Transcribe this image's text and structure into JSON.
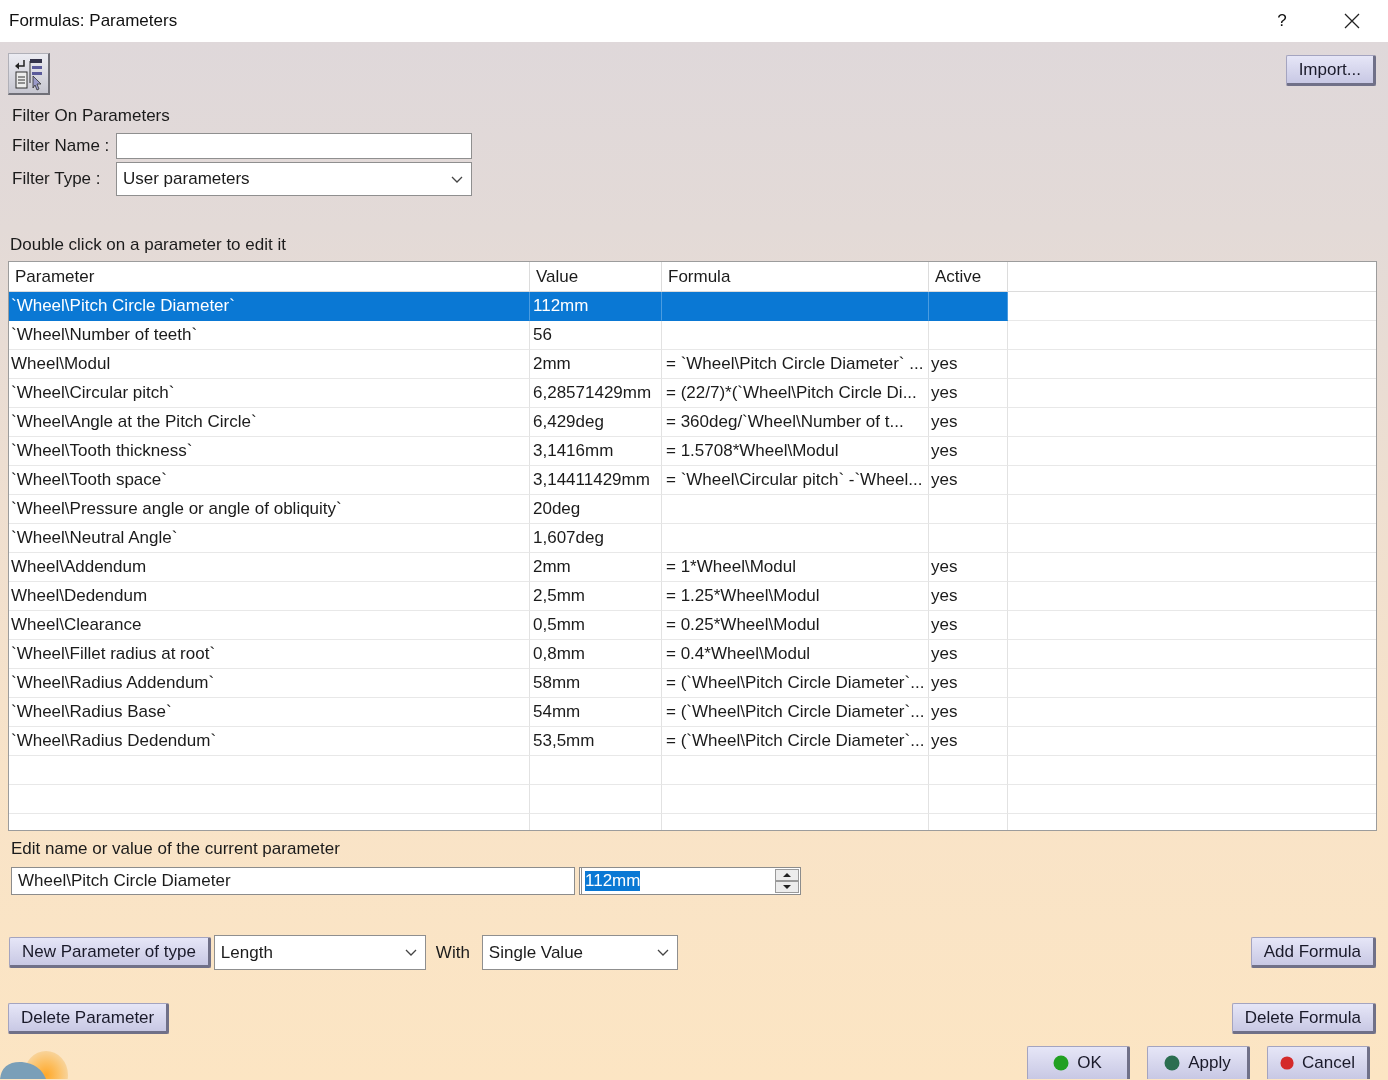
{
  "window": {
    "title": "Formulas: Parameters",
    "help": "?"
  },
  "toolbar": {
    "import_button": "Import..."
  },
  "filter": {
    "title": "Filter On Parameters",
    "name_label": "Filter Name :",
    "type_label": "Filter Type :",
    "type_value": "User parameters"
  },
  "table": {
    "hint": "Double click on a parameter to edit it",
    "columns": [
      "Parameter",
      "Value",
      "Formula",
      "Active"
    ],
    "rows": [
      {
        "parameter": "`Wheel\\Pitch Circle Diameter`",
        "value": "112mm",
        "selected": true
      },
      {
        "parameter": "`Wheel\\Number of teeth`",
        "value": "56",
        "selected": false
      },
      {
        "parameter": "Wheel\\Modul",
        "value": "2mm",
        "formula": "= `Wheel\\Pitch Circle Diameter` ...",
        "active": "yes",
        "selected": false
      },
      {
        "parameter": "`Wheel\\Circular pitch`",
        "value": "6,28571429mm",
        "formula": "= (22/7)*(`Wheel\\Pitch Circle Di...",
        "active": "yes",
        "selected": false
      },
      {
        "parameter": "`Wheel\\Angle at the Pitch Circle`",
        "value": "6,429deg",
        "formula": "= 360deg/`Wheel\\Number of t...",
        "active": "yes",
        "selected": false
      },
      {
        "parameter": "`Wheel\\Tooth thickness`",
        "value": "3,1416mm",
        "formula": "= 1.5708*Wheel\\Modul",
        "active": "yes",
        "selected": false
      },
      {
        "parameter": "`Wheel\\Tooth space`",
        "value": "3,14411429mm",
        "formula": "= `Wheel\\Circular pitch` -`Wheel...",
        "active": "yes",
        "selected": false
      },
      {
        "parameter": "`Wheel\\Pressure angle or angle of obliquity`",
        "value": "20deg",
        "selected": false
      },
      {
        "parameter": "`Wheel\\Neutral Angle`",
        "value": "1,607deg",
        "selected": false
      },
      {
        "parameter": "Wheel\\Addendum",
        "value": "2mm",
        "formula": "= 1*Wheel\\Modul",
        "active": "yes",
        "selected": false
      },
      {
        "parameter": "Wheel\\Dedendum",
        "value": "2,5mm",
        "formula": "= 1.25*Wheel\\Modul",
        "active": "yes",
        "selected": false
      },
      {
        "parameter": "Wheel\\Clearance",
        "value": "0,5mm",
        "formula": "= 0.25*Wheel\\Modul",
        "active": "yes",
        "selected": false
      },
      {
        "parameter": "`Wheel\\Fillet radius at root`",
        "value": "0,8mm",
        "formula": "= 0.4*Wheel\\Modul",
        "active": "yes",
        "selected": false
      },
      {
        "parameter": "`Wheel\\Radius Addendum`",
        "value": "58mm",
        "formula": "= (`Wheel\\Pitch Circle Diameter`...",
        "active": "yes",
        "selected": false
      },
      {
        "parameter": "`Wheel\\Radius Base`",
        "value": "54mm",
        "formula": "= (`Wheel\\Pitch Circle Diameter`...",
        "active": "yes",
        "selected": false
      },
      {
        "parameter": "`Wheel\\Radius Dedendum`",
        "value": "53,5mm",
        "formula": "= (`Wheel\\Pitch Circle Diameter`...",
        "active": "yes",
        "selected": false
      }
    ]
  },
  "editor": {
    "label": "Edit name or value of the current parameter",
    "name_value": "Wheel\\Pitch Circle Diameter",
    "value": "112mm",
    "value_text_selected": true
  },
  "new_parameter": {
    "button": "New Parameter of type",
    "type_value": "Length",
    "with_label": "With",
    "multiplicity_value": "Single Value",
    "add_formula_button": "Add Formula"
  },
  "delete_buttons": {
    "delete_parameter": "Delete Parameter",
    "delete_formula": "Delete Formula"
  },
  "dialog_buttons": [
    {
      "label": "OK",
      "color": "#22a022"
    },
    {
      "label": "Apply",
      "color": "#2b6e50"
    },
    {
      "label": "Cancel",
      "color": "#d42a2a"
    }
  ]
}
